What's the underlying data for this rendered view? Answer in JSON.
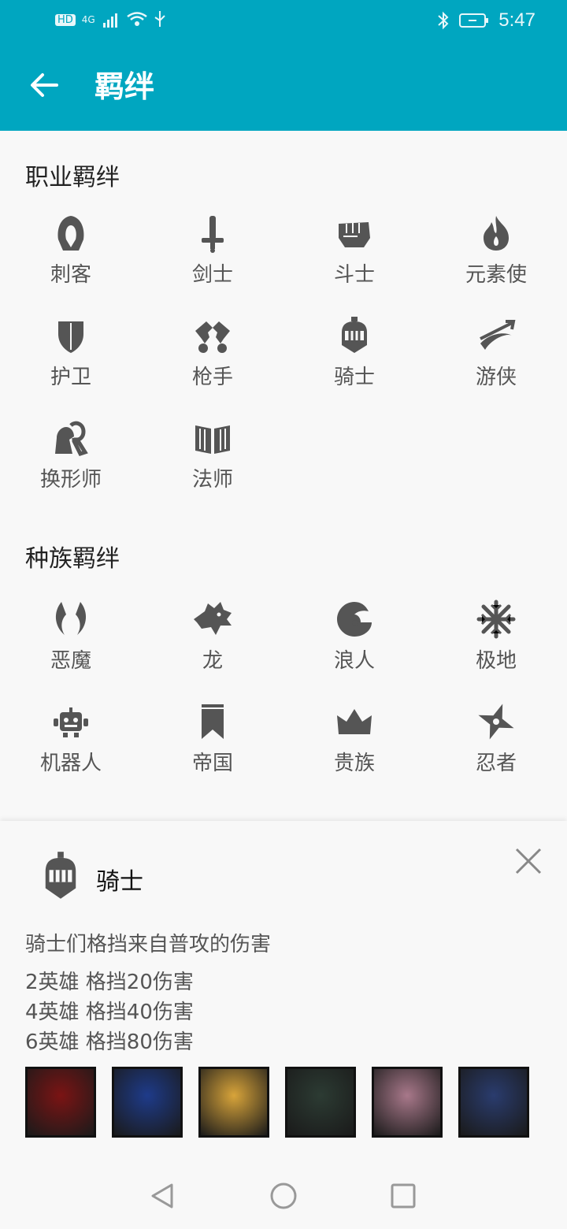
{
  "status": {
    "time": "5:47",
    "network": "4G",
    "hd": "HD"
  },
  "header": {
    "title": "羁绊"
  },
  "sections": {
    "class_title": "职业羁绊",
    "race_title": "种族羁绊"
  },
  "classes": [
    {
      "label": "刺客",
      "icon": "hood-icon"
    },
    {
      "label": "剑士",
      "icon": "sword-icon"
    },
    {
      "label": "斗士",
      "icon": "fist-icon"
    },
    {
      "label": "元素使",
      "icon": "flame-icon"
    },
    {
      "label": "护卫",
      "icon": "shield-icon"
    },
    {
      "label": "枪手",
      "icon": "pistols-icon"
    },
    {
      "label": "骑士",
      "icon": "knight-helmet-icon"
    },
    {
      "label": "游侠",
      "icon": "bow-icon"
    },
    {
      "label": "换形师",
      "icon": "shapeshifter-icon"
    },
    {
      "label": "法师",
      "icon": "book-icon"
    }
  ],
  "races": [
    {
      "label": "恶魔",
      "icon": "horns-icon"
    },
    {
      "label": "龙",
      "icon": "dragon-icon"
    },
    {
      "label": "浪人",
      "icon": "exile-icon"
    },
    {
      "label": "极地",
      "icon": "snowflake-icon"
    },
    {
      "label": "机器人",
      "icon": "robot-icon"
    },
    {
      "label": "帝国",
      "icon": "banner-icon"
    },
    {
      "label": "贵族",
      "icon": "crown-icon"
    },
    {
      "label": "忍者",
      "icon": "shuriken-icon"
    }
  ],
  "detail": {
    "name": "骑士",
    "description": "骑士们格挡来自普攻的伤害",
    "tiers": [
      "2英雄 格挡20伤害",
      "4英雄 格挡40伤害",
      "6英雄 格挡80伤害"
    ],
    "portrait_colors": [
      "#7b1414",
      "#1e3b8a",
      "#d8a43a",
      "#2c3b33",
      "#a8788a",
      "#2a3c6e"
    ]
  }
}
